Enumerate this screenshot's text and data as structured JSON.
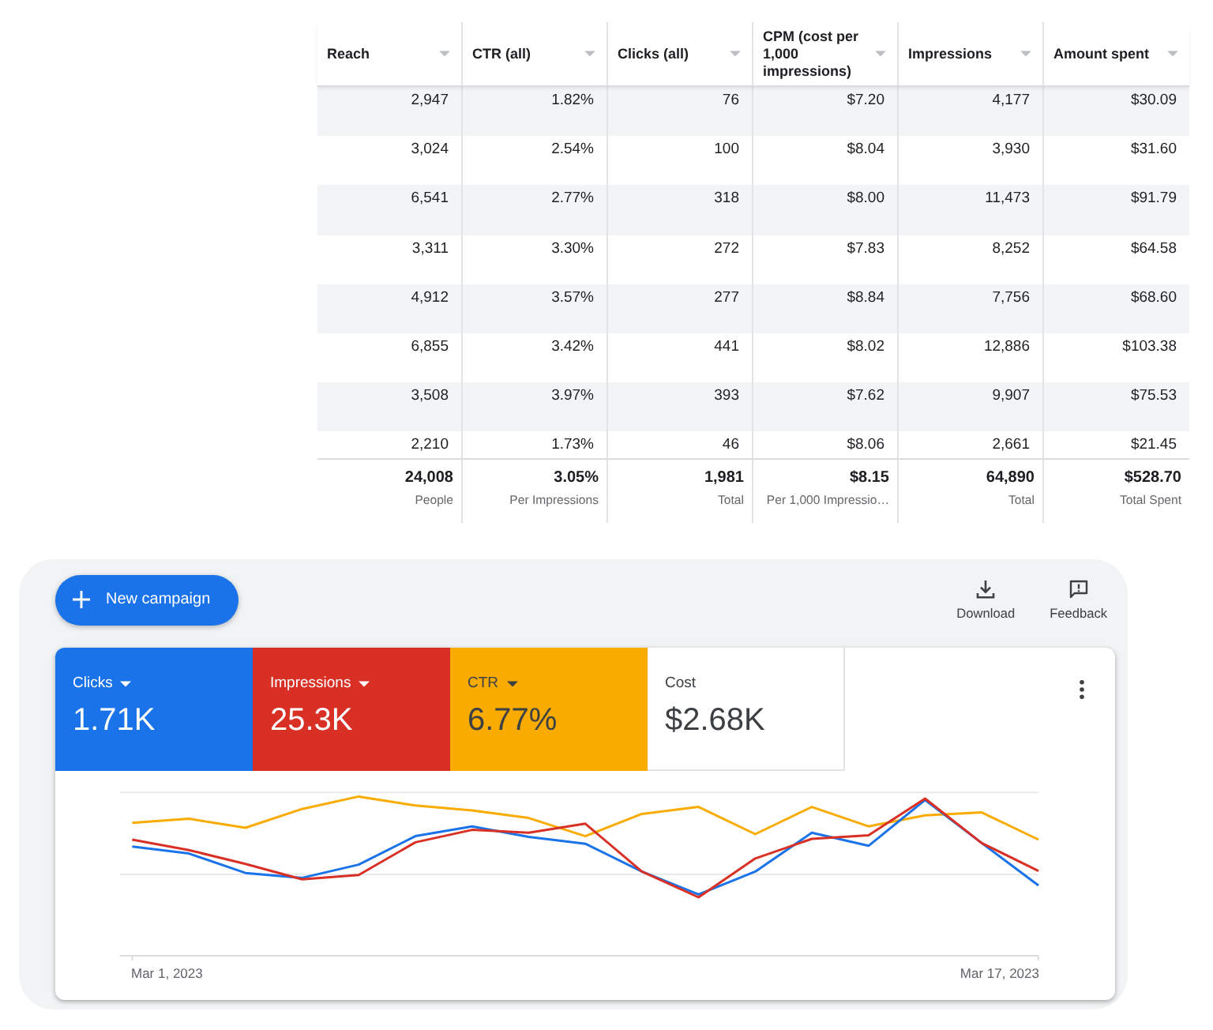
{
  "table": {
    "columns": [
      "Reach",
      "CTR (all)",
      "Clicks (all)",
      "CPM (cost per 1,000 impressions)",
      "Impressions",
      "Amount spent"
    ],
    "rows": [
      [
        "2,947",
        "1.82%",
        "76",
        "$7.20",
        "4,177",
        "$30.09"
      ],
      [
        "3,024",
        "2.54%",
        "100",
        "$8.04",
        "3,930",
        "$31.60"
      ],
      [
        "6,541",
        "2.77%",
        "318",
        "$8.00",
        "11,473",
        "$91.79"
      ],
      [
        "3,311",
        "3.30%",
        "272",
        "$7.83",
        "8,252",
        "$64.58"
      ],
      [
        "4,912",
        "3.57%",
        "277",
        "$8.84",
        "7,756",
        "$68.60"
      ],
      [
        "6,855",
        "3.42%",
        "441",
        "$8.02",
        "12,886",
        "$103.38"
      ],
      [
        "3,508",
        "3.97%",
        "393",
        "$7.62",
        "9,907",
        "$75.53"
      ],
      [
        "2,210",
        "1.73%",
        "46",
        "$8.06",
        "2,661",
        "$21.45"
      ]
    ],
    "totals": [
      {
        "value": "24,008",
        "label": "People"
      },
      {
        "value": "3.05%",
        "label": "Per Impressions"
      },
      {
        "value": "1,981",
        "label": "Total"
      },
      {
        "value": "$8.15",
        "label": "Per 1,000 Impressio…"
      },
      {
        "value": "64,890",
        "label": "Total"
      },
      {
        "value": "$528.70",
        "label": "Total Spent"
      }
    ]
  },
  "toolbar": {
    "new_button": "New campaign",
    "actions": [
      {
        "kind": "download",
        "label": "Download"
      },
      {
        "kind": "feedback",
        "label": "Feedback"
      }
    ]
  },
  "metrics": [
    {
      "label": "Clicks",
      "value": "1.71K",
      "selected": true,
      "color": "#1a73e8"
    },
    {
      "label": "Impressions",
      "value": "25.3K",
      "selected": true,
      "color": "#d93025"
    },
    {
      "label": "CTR",
      "value": "6.77%",
      "selected": true,
      "color": "#f9ab00"
    },
    {
      "label": "Cost",
      "value": "$2.68K",
      "selected": false
    }
  ],
  "chart": {
    "x_labels": [
      "Mar 1, 2023",
      "Mar 17, 2023"
    ]
  }
}
